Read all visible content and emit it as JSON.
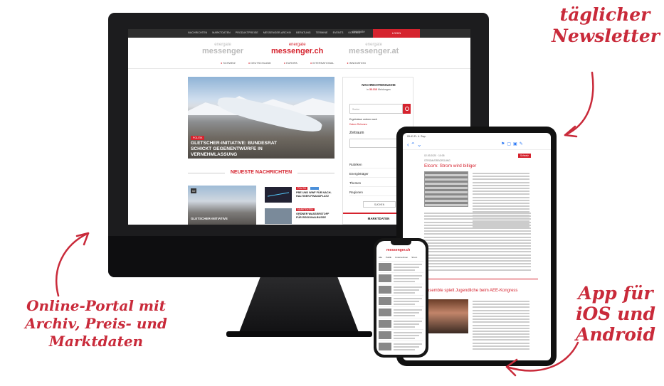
{
  "annotations": {
    "newsletter": [
      "täglicher",
      "Newsletter"
    ],
    "portal": [
      "Online-Portal mit",
      "Archiv, Preis- und",
      "Marktdaten"
    ],
    "app": [
      "App für",
      "iOS und",
      "Android"
    ]
  },
  "site": {
    "topnav": [
      "NACHRICHTEN",
      "MARKTDATEN",
      "PRODUKTPREISE",
      "MESSENGER-ARCHIV",
      "BERATUNG",
      "TERMINE",
      "EVENTS",
      "KONTAKT"
    ],
    "enercast": "energate",
    "login": "LOGIN",
    "logos": {
      "left": {
        "l1": "energate",
        "l2": "messenger"
      },
      "main": {
        "l1": "energate",
        "l2": "messenger.ch"
      },
      "right": {
        "l1": "energate",
        "l2": "messenger.at"
      }
    },
    "regions": [
      "SCHWEIZ",
      "DEUTSCHLAND",
      "EUROPA",
      "INTERNATIONAL",
      "INNOVATION"
    ],
    "hero": {
      "tag": "POLITIK",
      "title": "GLETSCHER-INITIATIVE: BUNDESRAT SCHICKT GEGENENTWÜRFE IN VERNEHMLASSUNG"
    },
    "neueste": "NEUESTE NACHRICHTEN",
    "news": [
      {
        "tag": "POLITIK",
        "title": "PBE UND WWF FÜR NACH-HALTIGEN FINANZPLATZ"
      },
      {
        "tag": "MARKTDATEN",
        "title": "GRÜNER WASSERSTOFF FÜR REGIONALBUSSE"
      }
    ],
    "thumb_date": "02",
    "thumb_title": "GLETSCHER-INITIATIVE",
    "sidebar": {
      "title": "NACHRICHTENSUCHE",
      "sub_prefix": "in",
      "count": "33.313",
      "sub_suffix": "Meldungen",
      "placeholder": "Suche",
      "sort": "Ergebnisse ordnen nach",
      "opts": "Datum  Relevanz",
      "zeitraum": "Zeitraum",
      "rows": [
        "Rubriken",
        "Energieträger",
        "Themen",
        "Regionen"
      ],
      "button": "SUCHEN",
      "marktdaten": "MARKTDATEN"
    }
  },
  "ipad": {
    "status": "09:41  Fr. 4. Sep.",
    "date": "02.09.2020 · 10:05",
    "tag": "Schweiz",
    "cat": "STROMVERSORGUNG",
    "title": "Elcom: Strom wird billiger",
    "title2": "Ensemble spielt Jugendliche beim AEE-Kongress"
  },
  "iphone": {
    "logo": "messenger.ch",
    "tabs": [
      "Alle",
      "Politik",
      "Unternehmen",
      "Strom"
    ]
  }
}
